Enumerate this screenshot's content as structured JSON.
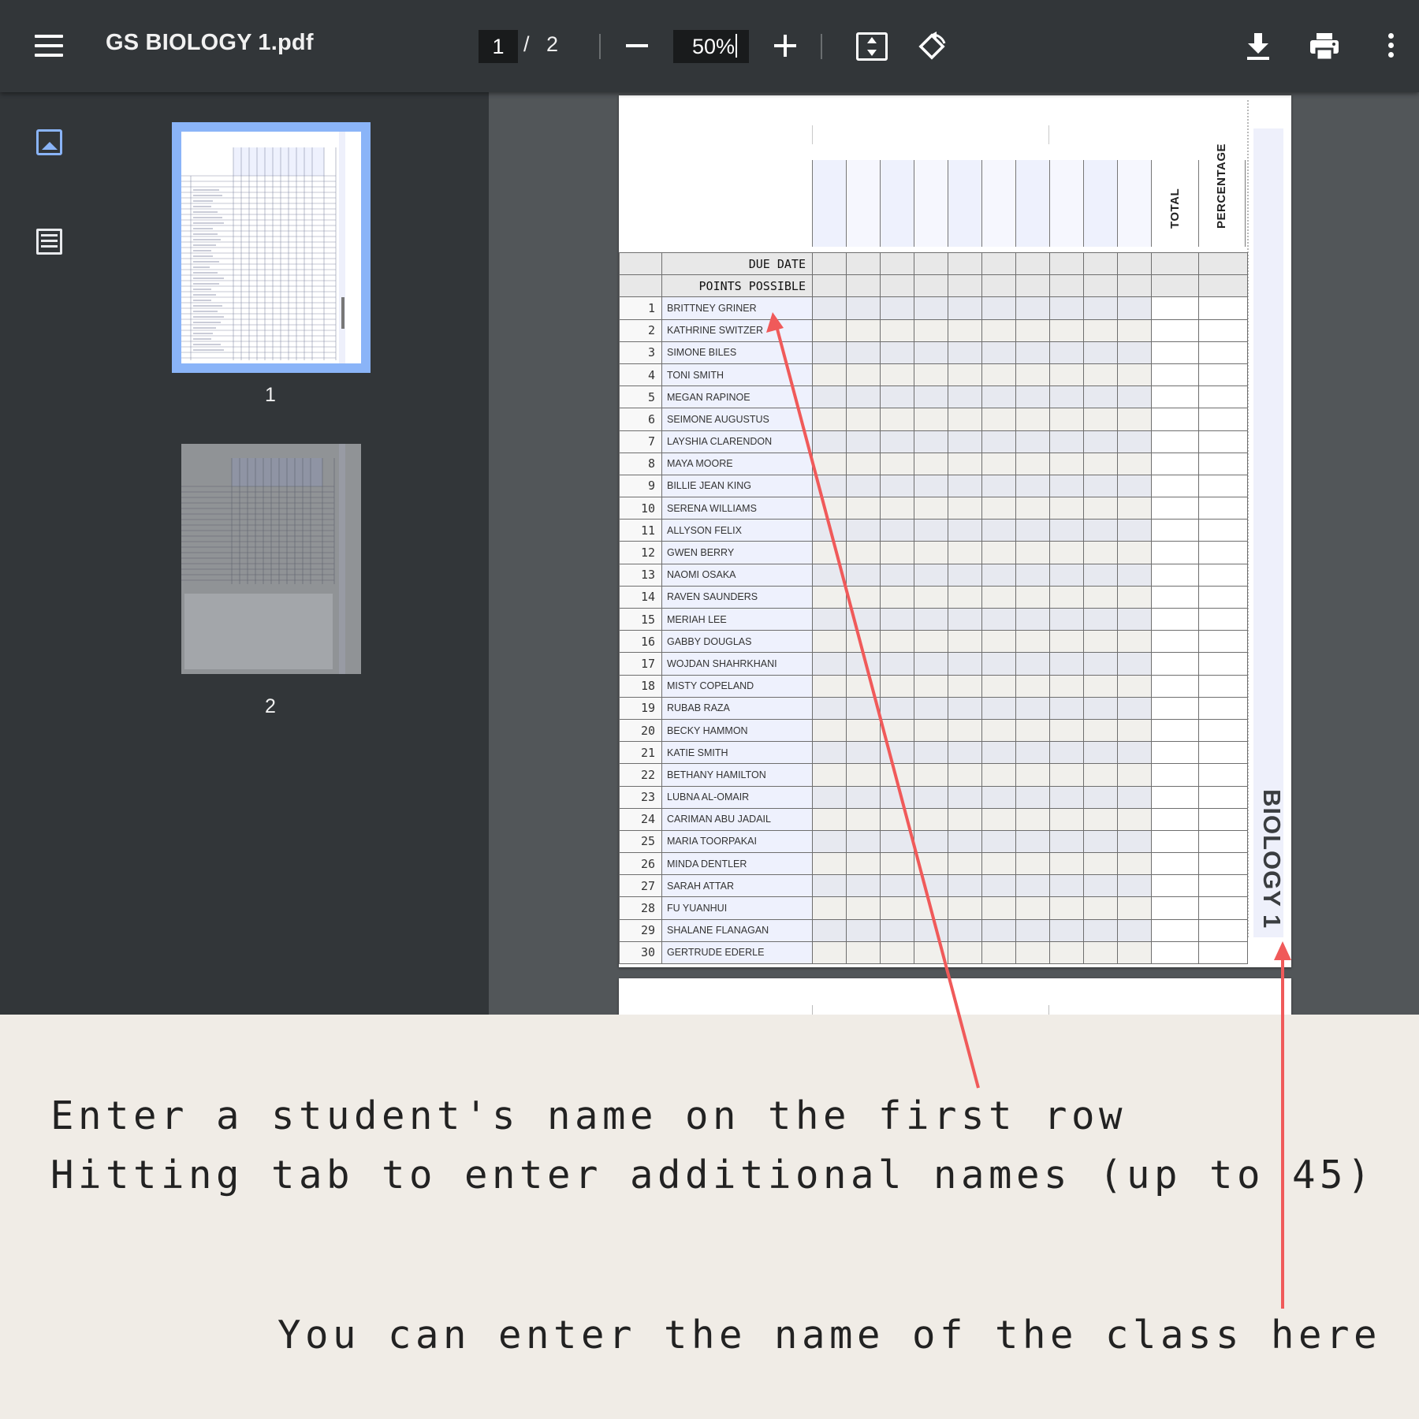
{
  "toolbar": {
    "file_name": "GS BIOLOGY 1.pdf",
    "current_page": "1",
    "page_separator": "/",
    "total_pages": "2",
    "zoom_level": "50%",
    "icons": [
      "menu-icon",
      "zoom-out-icon",
      "zoom-in-icon",
      "fit-to-page-icon",
      "rotate-icon",
      "download-icon",
      "print-icon",
      "more-options-icon"
    ]
  },
  "sidebar": {
    "view_icons": [
      "thumbnail-view-icon",
      "document-outline-icon"
    ],
    "thumbnails": [
      {
        "page_number": "1",
        "selected": true
      },
      {
        "page_number": "2",
        "selected": false
      }
    ],
    "accent_color": "#8ab4f8"
  },
  "gradebook": {
    "due_date_label": "DUE DATE",
    "points_possible_label": "POINTS POSSIBLE",
    "total_label": "TOTAL",
    "percentage_label": "PERCENTAGE",
    "class_name": "BIOLOGY 1",
    "students": [
      {
        "num": "1",
        "name": "BRITTNEY GRINER"
      },
      {
        "num": "2",
        "name": "KATHRINE SWITZER"
      },
      {
        "num": "3",
        "name": "SIMONE BILES"
      },
      {
        "num": "4",
        "name": "TONI SMITH"
      },
      {
        "num": "5",
        "name": "MEGAN RAPINOE"
      },
      {
        "num": "6",
        "name": "SEIMONE AUGUSTUS"
      },
      {
        "num": "7",
        "name": "LAYSHIA CLARENDON"
      },
      {
        "num": "8",
        "name": "MAYA MOORE"
      },
      {
        "num": "9",
        "name": "BILLIE JEAN KING"
      },
      {
        "num": "10",
        "name": "SERENA WILLIAMS"
      },
      {
        "num": "11",
        "name": "ALLYSON FELIX"
      },
      {
        "num": "12",
        "name": "GWEN BERRY"
      },
      {
        "num": "13",
        "name": "NAOMI OSAKA"
      },
      {
        "num": "14",
        "name": "RAVEN SAUNDERS"
      },
      {
        "num": "15",
        "name": "MERIAH LEE"
      },
      {
        "num": "16",
        "name": "GABBY DOUGLAS"
      },
      {
        "num": "17",
        "name": "WOJDAN SHAHRKHANI"
      },
      {
        "num": "18",
        "name": "MISTY COPELAND"
      },
      {
        "num": "19",
        "name": "RUBAB RAZA"
      },
      {
        "num": "20",
        "name": "BECKY HAMMON"
      },
      {
        "num": "21",
        "name": "KATIE SMITH"
      },
      {
        "num": "22",
        "name": "BETHANY HAMILTON"
      },
      {
        "num": "23",
        "name": "LUBNA AL-OMAIR"
      },
      {
        "num": "24",
        "name": "CARIMAN ABU JADAIL"
      },
      {
        "num": "25",
        "name": "MARIA TOORPAKAI"
      },
      {
        "num": "26",
        "name": "MINDA DENTLER"
      },
      {
        "num": "27",
        "name": "SARAH ATTAR"
      },
      {
        "num": "28",
        "name": "FU YUANHUI"
      },
      {
        "num": "29",
        "name": "SHALANE FLANAGAN"
      },
      {
        "num": "30",
        "name": "GERTRUDE EDERLE"
      }
    ]
  },
  "caption": {
    "line1": "Enter a student's name on the first row",
    "line2": "Hitting tab to enter additional names (up to 45)",
    "line3": "You can enter the name of the class here",
    "arrow_color": "#f05a5a"
  }
}
